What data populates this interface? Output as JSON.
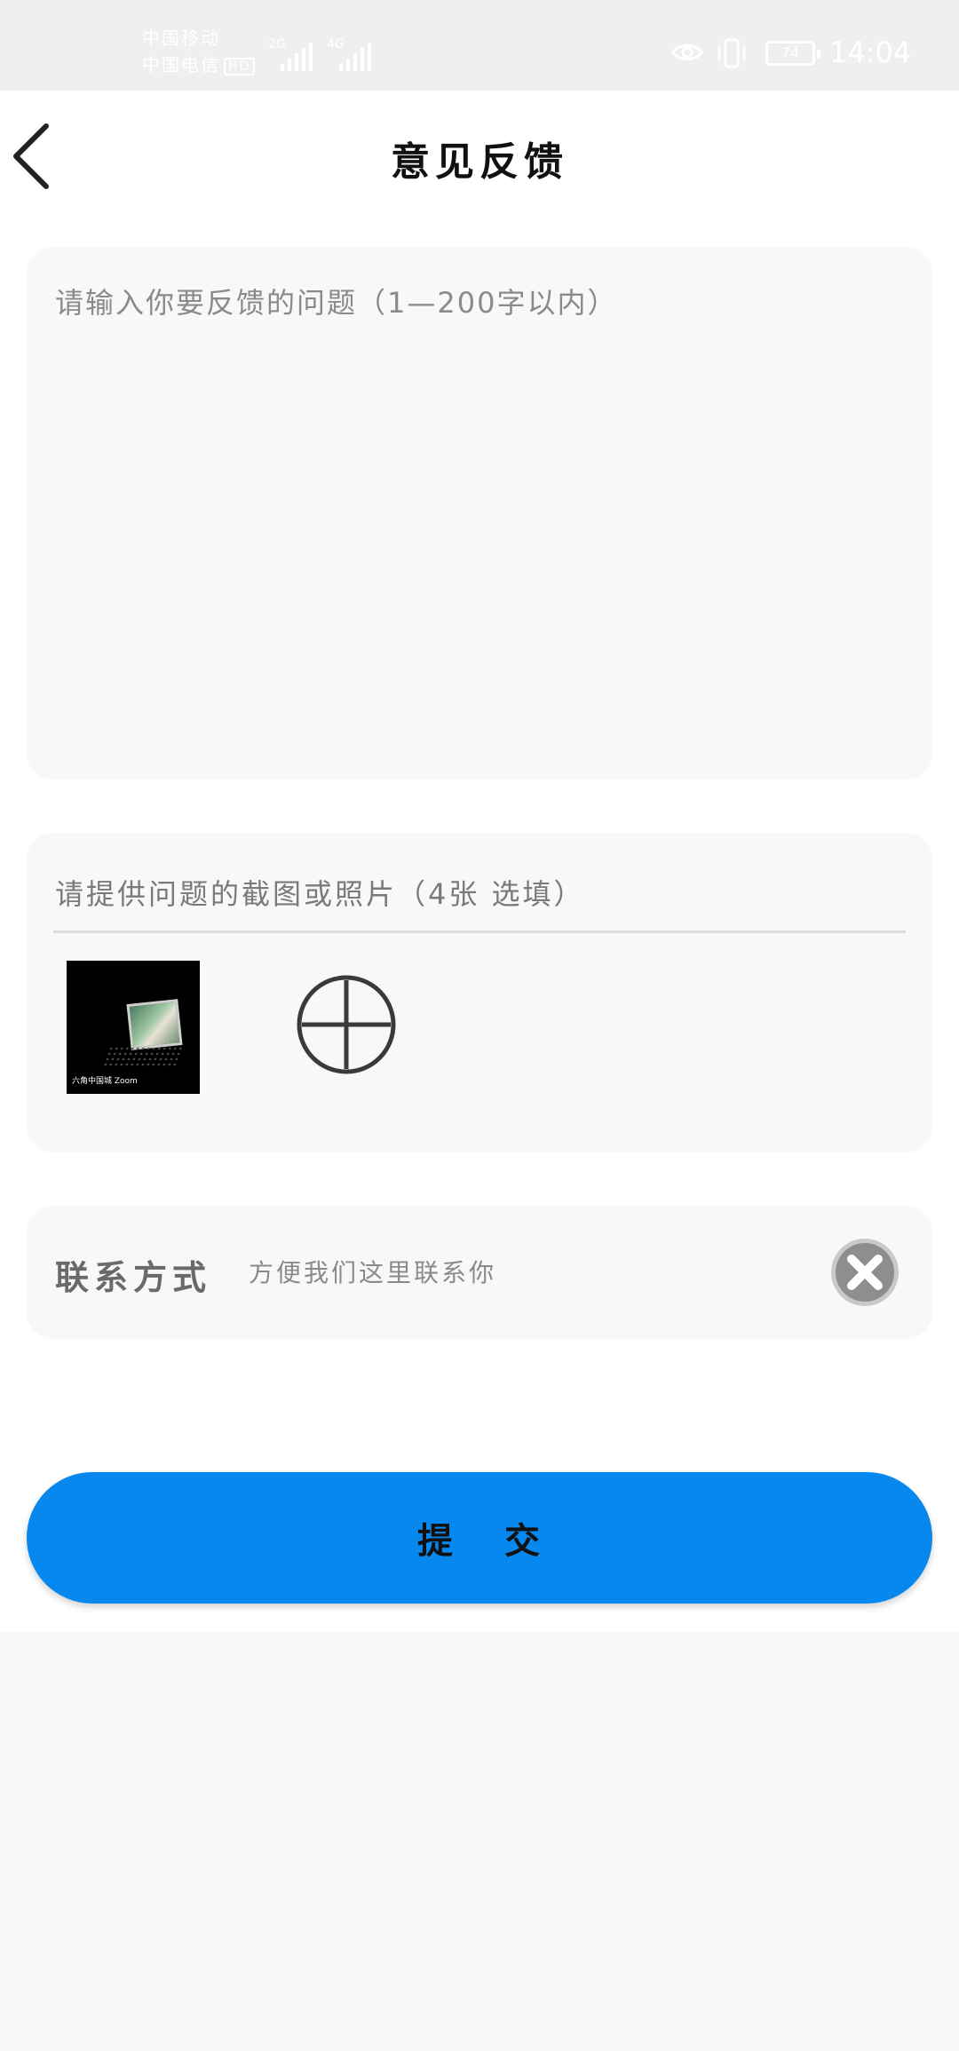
{
  "status_bar": {
    "carrier_1": "中国移动",
    "carrier_2": "中国电信",
    "hd_badge": "HD",
    "network_1": "2G",
    "network_2": "4G",
    "battery": "74",
    "time": "14:04",
    "icons": [
      "eye-icon",
      "vibrate-icon",
      "battery-icon"
    ]
  },
  "header": {
    "title": "意见反馈",
    "back_icon": "chevron-left-icon"
  },
  "feedback": {
    "placeholder": "请输入你要反馈的问题（1—200字以内）",
    "value": ""
  },
  "upload": {
    "label": "请提供问题的截图或照片（4张 选填）",
    "thumbnail_caption": "六角中国城 Zoom",
    "add_icon": "plus-circle-icon"
  },
  "contact": {
    "label": "联系方式",
    "placeholder": "方便我们这里联系你",
    "value": "",
    "clear_icon": "clear-x-icon"
  },
  "submit": {
    "label": "提 交"
  },
  "colors": {
    "accent": "#0788ef",
    "card_bg": "#f8f8f8",
    "status_bar_bg": "#efefef",
    "page_bg": "#f9f9f9"
  }
}
